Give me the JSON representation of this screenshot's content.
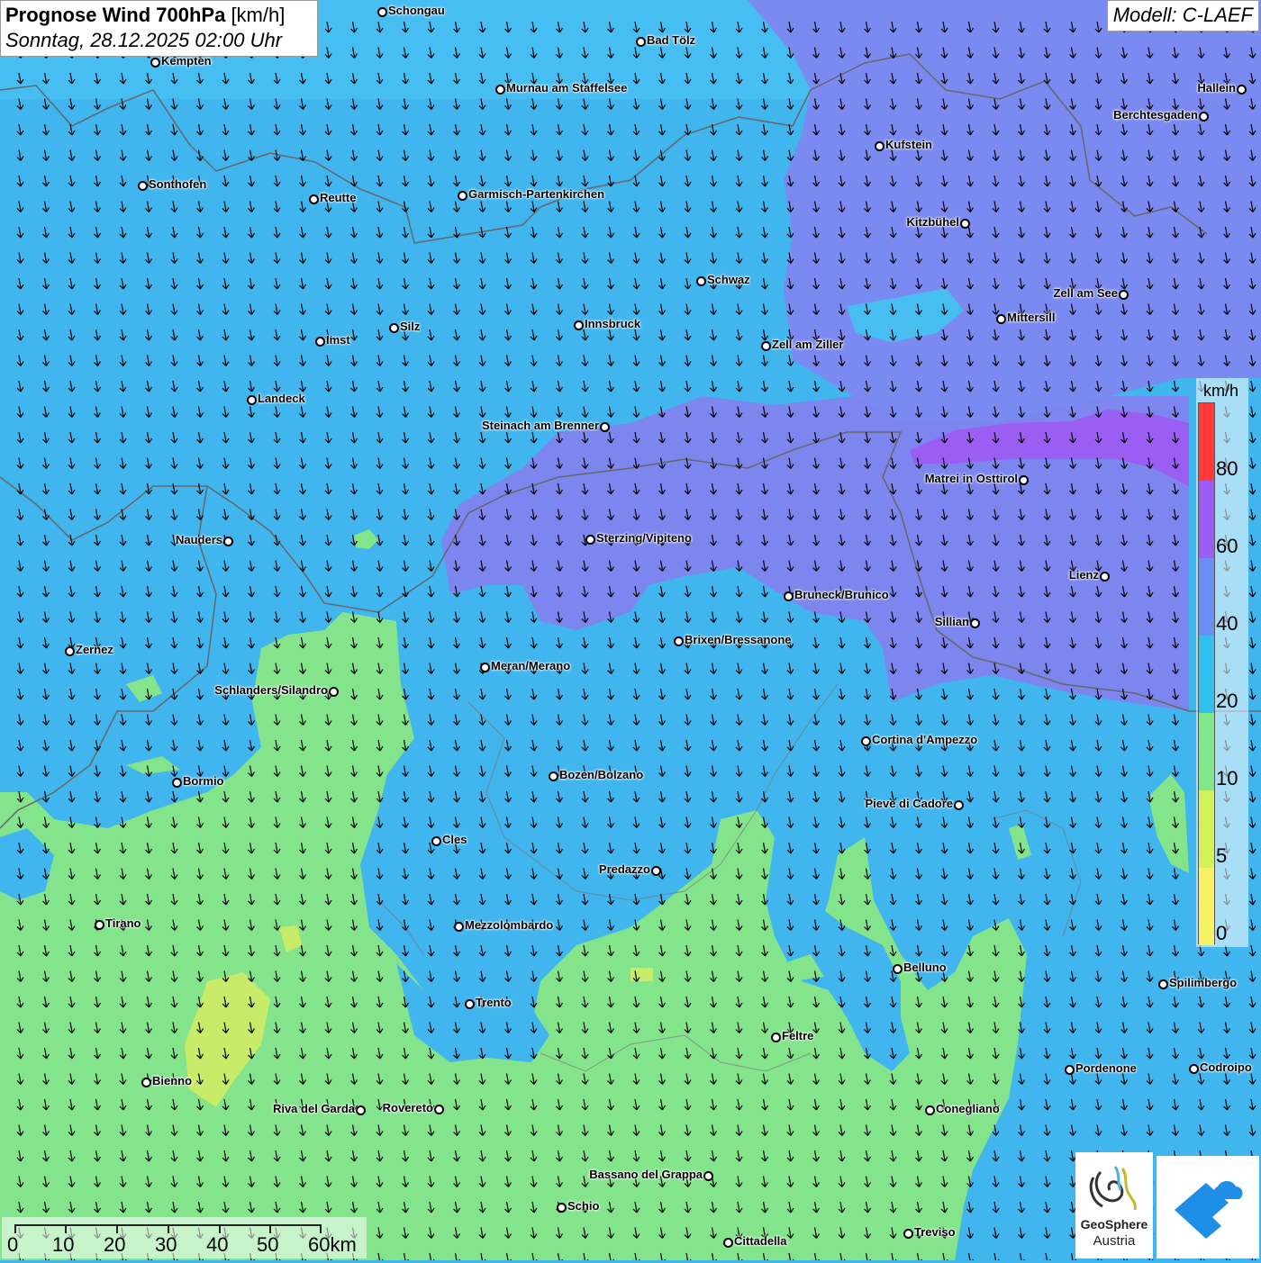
{
  "header": {
    "title_bold": "Prognose Wind 700hPa",
    "title_unit": "[km/h]",
    "datetime": "Sonntag, 28.12.2025 02:00 Uhr",
    "model": "Modell: C-LAEF"
  },
  "legend": {
    "unit": "km/h",
    "ticks": [
      "80",
      "60",
      "40",
      "20",
      "10",
      "5",
      "0"
    ],
    "colors": [
      "#ff3a3a",
      "#9a5cf2",
      "#6b8ef2",
      "#2fc0ee",
      "#7ee88a",
      "#d2f25a",
      "#f7f264"
    ]
  },
  "scalebar": {
    "labels": [
      "0",
      "10",
      "20",
      "30",
      "40",
      "50",
      "60km"
    ]
  },
  "logo": {
    "line1": "GeoSphere",
    "line2": "Austria"
  },
  "cities": [
    {
      "name": "Schongau"
    },
    {
      "name": "Bad Tölz"
    },
    {
      "name": "Kempten"
    },
    {
      "name": "Murnau am Staffelsee"
    },
    {
      "name": "Hallein"
    },
    {
      "name": "Berchtesgaden"
    },
    {
      "name": "Kufstein"
    },
    {
      "name": "Sonthofen"
    },
    {
      "name": "Reutte"
    },
    {
      "name": "Garmisch-Partenkirchen"
    },
    {
      "name": "Kitzbühel"
    },
    {
      "name": "Schwaz"
    },
    {
      "name": "Zell am See"
    },
    {
      "name": "Mittersill"
    },
    {
      "name": "Innsbruck"
    },
    {
      "name": "Silz"
    },
    {
      "name": "Imst"
    },
    {
      "name": "Zell am Ziller"
    },
    {
      "name": "Landeck"
    },
    {
      "name": "Steinach am Brenner"
    },
    {
      "name": "Matrei in Osttirol"
    },
    {
      "name": "Nauders"
    },
    {
      "name": "Sterzing/Vipiteno"
    },
    {
      "name": "Lienz"
    },
    {
      "name": "Bruneck/Brunico"
    },
    {
      "name": "Sillian"
    },
    {
      "name": "Zernez"
    },
    {
      "name": "Brixen/Bressanone"
    },
    {
      "name": "Meran/Merano"
    },
    {
      "name": "Schlanders/Silandro"
    },
    {
      "name": "Cortina d'Ampezzo"
    },
    {
      "name": "Bozen/Bolzano"
    },
    {
      "name": "Bormio"
    },
    {
      "name": "Pieve di Cadore"
    },
    {
      "name": "Cles"
    },
    {
      "name": "Predazzo"
    },
    {
      "name": "Tirano"
    },
    {
      "name": "Mezzolombardo"
    },
    {
      "name": "Belluno"
    },
    {
      "name": "Spilimbergo"
    },
    {
      "name": "Trento"
    },
    {
      "name": "Feltre"
    },
    {
      "name": "Pordenone"
    },
    {
      "name": "Codroipo"
    },
    {
      "name": "Bienno"
    },
    {
      "name": "Riva del Garda"
    },
    {
      "name": "Rovereto"
    },
    {
      "name": "Conegliano"
    },
    {
      "name": "Bassano del Grappa"
    },
    {
      "name": "Schio"
    },
    {
      "name": "Treviso"
    },
    {
      "name": "Cittadella"
    }
  ],
  "wind": {
    "direction": "from north",
    "color_note": "speed classes per legend"
  }
}
